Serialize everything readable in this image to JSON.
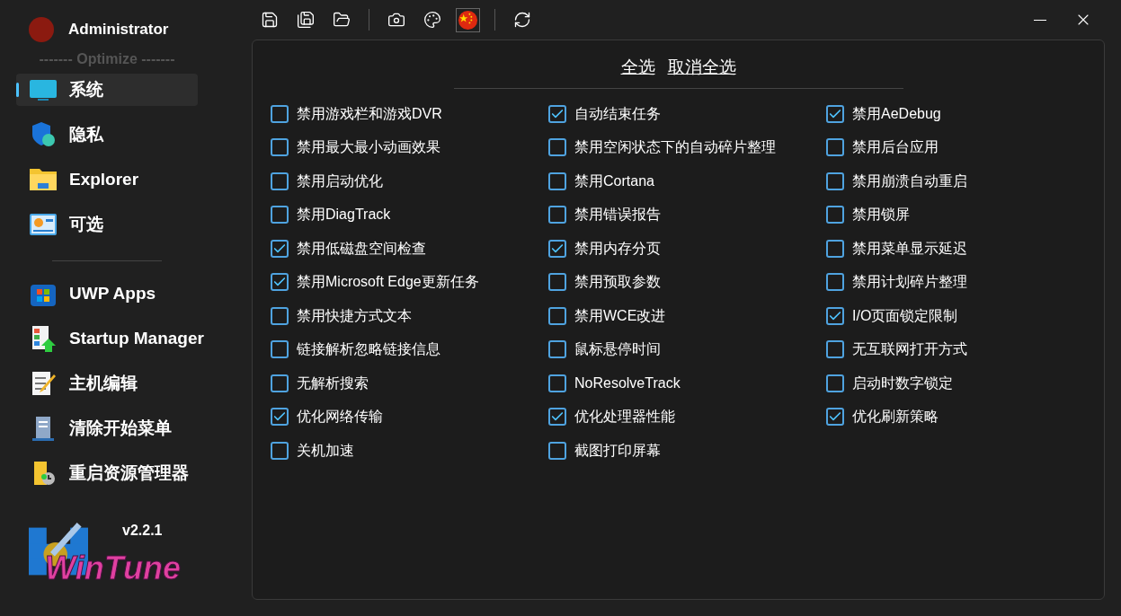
{
  "user": {
    "name": "Administrator"
  },
  "sidebar": {
    "section_title": "------- Optimize -------",
    "items": [
      {
        "label": "系统",
        "selected": true
      },
      {
        "label": "隐私",
        "selected": false
      },
      {
        "label": "Explorer",
        "selected": false
      },
      {
        "label": "可选",
        "selected": false
      }
    ],
    "tools": [
      {
        "label": "UWP Apps"
      },
      {
        "label": "Startup Manager"
      },
      {
        "label": "主机编辑"
      },
      {
        "label": "清除开始菜单"
      },
      {
        "label": "重启资源管理器"
      }
    ],
    "version": "v2.2.1",
    "logo_text": "WinTune"
  },
  "toolbar": [
    {
      "kind": "save"
    },
    {
      "kind": "save_as"
    },
    {
      "kind": "open"
    },
    {
      "kind": "sep"
    },
    {
      "kind": "camera"
    },
    {
      "kind": "palette"
    },
    {
      "kind": "flag"
    },
    {
      "kind": "sep"
    },
    {
      "kind": "refresh"
    }
  ],
  "actions": {
    "select_all": "全选",
    "deselect_all": "取消全选"
  },
  "columns": [
    [
      {
        "label": "禁用游戏栏和游戏DVR",
        "checked": false
      },
      {
        "label": "禁用最大最小动画效果",
        "checked": false
      },
      {
        "label": "禁用启动优化",
        "checked": false
      },
      {
        "label": "禁用DiagTrack",
        "checked": false
      },
      {
        "label": "禁用低磁盘空间检查",
        "checked": true
      },
      {
        "label": "禁用Microsoft Edge更新任务",
        "checked": true
      },
      {
        "label": "禁用快捷方式文本",
        "checked": false
      },
      {
        "label": "链接解析忽略链接信息",
        "checked": false
      },
      {
        "label": "无解析搜索",
        "checked": false
      },
      {
        "label": "优化网络传输",
        "checked": true
      },
      {
        "label": "关机加速",
        "checked": false
      }
    ],
    [
      {
        "label": "自动结束任务",
        "checked": true
      },
      {
        "label": "禁用空闲状态下的自动碎片整理",
        "checked": false
      },
      {
        "label": "禁用Cortana",
        "checked": false
      },
      {
        "label": "禁用错误报告",
        "checked": false
      },
      {
        "label": "禁用内存分页",
        "checked": true
      },
      {
        "label": "禁用预取参数",
        "checked": false
      },
      {
        "label": "禁用WCE改进",
        "checked": false
      },
      {
        "label": "鼠标悬停时间",
        "checked": false
      },
      {
        "label": "NoResolveTrack",
        "checked": false
      },
      {
        "label": "优化处理器性能",
        "checked": true
      },
      {
        "label": "截图打印屏幕",
        "checked": false
      }
    ],
    [
      {
        "label": "禁用AeDebug",
        "checked": true
      },
      {
        "label": "禁用后台应用",
        "checked": false
      },
      {
        "label": "禁用崩溃自动重启",
        "checked": false
      },
      {
        "label": "禁用锁屏",
        "checked": false
      },
      {
        "label": "禁用菜单显示延迟",
        "checked": false
      },
      {
        "label": "禁用计划碎片整理",
        "checked": false
      },
      {
        "label": "I/O页面锁定限制",
        "checked": true
      },
      {
        "label": "无互联网打开方式",
        "checked": false
      },
      {
        "label": "启动时数字锁定",
        "checked": false
      },
      {
        "label": "优化刷新策略",
        "checked": true
      }
    ]
  ]
}
